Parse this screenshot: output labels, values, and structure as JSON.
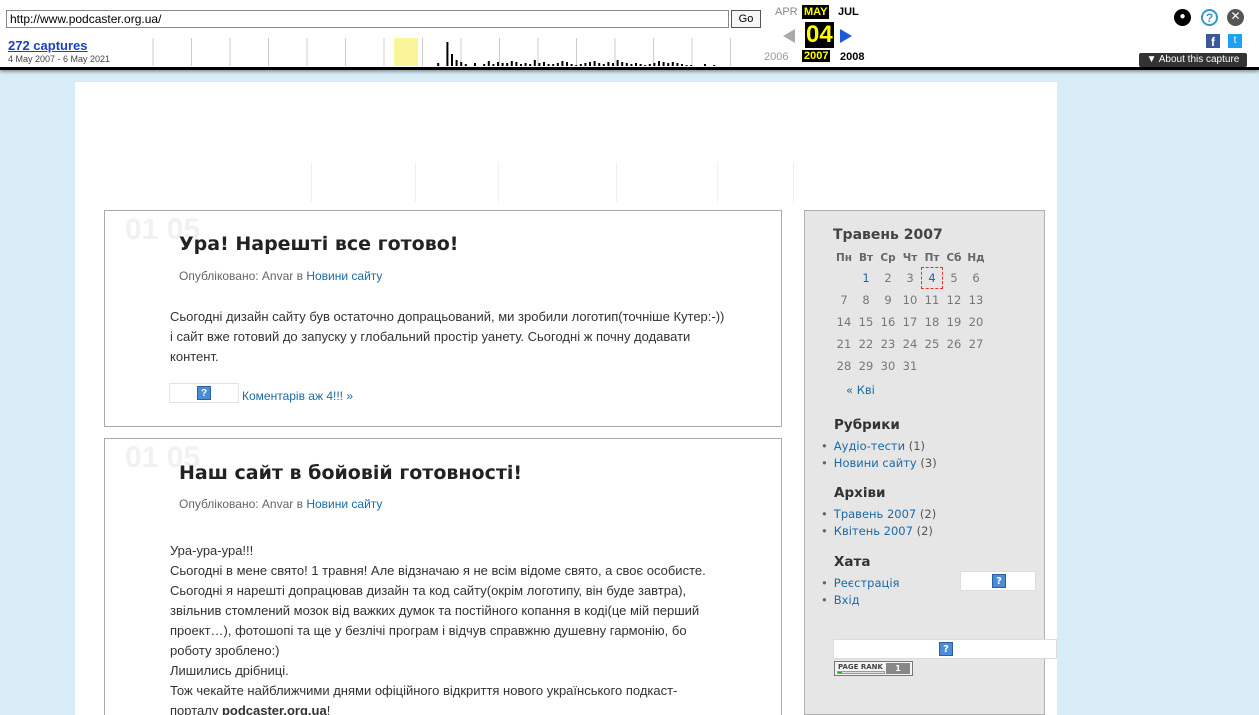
{
  "wayback": {
    "url": "http://www.podcaster.org.ua/",
    "go_label": "Go",
    "captures_label": "272 captures",
    "captures_range": "4 May 2007 - 6 May 2021",
    "month_prev": "APR",
    "month_current": "MAY",
    "month_next": "JUL",
    "day": "04",
    "year_prev": "2006",
    "year_current": "2007",
    "year_next": "2008",
    "about_label": "▼ About this capture",
    "icons": [
      "user-icon",
      "help-icon",
      "close-icon",
      "facebook-icon",
      "twitter-icon"
    ]
  },
  "posts": [
    {
      "date_ghost": "01 05",
      "title": "Ура! Нарешті все готово!",
      "meta_prefix": "Опубліковано: Anvar в ",
      "category": "Новини сайту",
      "body": "Сьогодні дизайн сайту був остаточно допрацьований, ми зробили логотип(точніше Кутер:-)) і сайт вже готовий до запуску у глобальний простір уанету. Сьогодні ж почну додавати контент.",
      "comments": "Коментарів аж 4!!! »"
    },
    {
      "date_ghost": "01 05",
      "title": "Наш сайт в бойовій готовності!",
      "meta_prefix": "Опубліковано: Anvar в ",
      "category": "Новини сайту",
      "lines": [
        "Ура-ура-ура!!!",
        "Сьогодні в мене свято! 1 травня! Але відзначаю я не всім відоме свято, а своє особисте.",
        "Сьогодні я нарешті допрацював дизайн та код сайту(окрім логотипу, він буде завтра),",
        "звільнив стомлений мозок від важких думок та постійного копання в коді(це мій перший",
        "проект…), фотошопі та ще у безлічі програм і відчув справжню душевну гармонію, бо",
        "роботу зроблено:)",
        "Лишились дрібниці.",
        "Тож чекайте найближчими днями офіційного відкриття нового українського подкаст-"
      ],
      "last_prefix": "порталу ",
      "last_bold": "podcaster.org.ua",
      "last_suffix": "!"
    }
  ],
  "sidebar": {
    "calendar": {
      "title": "Травень 2007",
      "weekdays": [
        "Пн",
        "Вт",
        "Ср",
        "Чт",
        "Пт",
        "Сб",
        "Нд"
      ],
      "weeks": [
        [
          "",
          "1",
          "2",
          "3",
          "4",
          "5",
          "6"
        ],
        [
          "7",
          "8",
          "9",
          "10",
          "11",
          "12",
          "13"
        ],
        [
          "14",
          "15",
          "16",
          "17",
          "18",
          "19",
          "20"
        ],
        [
          "21",
          "22",
          "23",
          "24",
          "25",
          "26",
          "27"
        ],
        [
          "28",
          "29",
          "30",
          "31",
          "",
          "",
          ""
        ]
      ],
      "linked_days": [
        "1"
      ],
      "today": "4",
      "prev_link": "« Кві"
    },
    "categories": {
      "heading": "Рубрики",
      "items": [
        {
          "label": "Аудіо-тести",
          "count": "(1)"
        },
        {
          "label": "Новини сайту",
          "count": "(3)"
        }
      ]
    },
    "archives": {
      "heading": "Архіви",
      "items": [
        {
          "label": "Травень 2007",
          "count": "(2)"
        },
        {
          "label": "Квітень 2007",
          "count": "(2)"
        }
      ]
    },
    "meta": {
      "heading": "Хата",
      "items": [
        {
          "label": "Реєстрація"
        },
        {
          "label": "Вхід"
        }
      ]
    },
    "pagerank": {
      "label": "PAGE RANK",
      "value": "1"
    }
  },
  "colors": {
    "page_bg": "#d7ecf6",
    "link": "#1b6aa5",
    "wayback_highlight": "#ffff00"
  }
}
